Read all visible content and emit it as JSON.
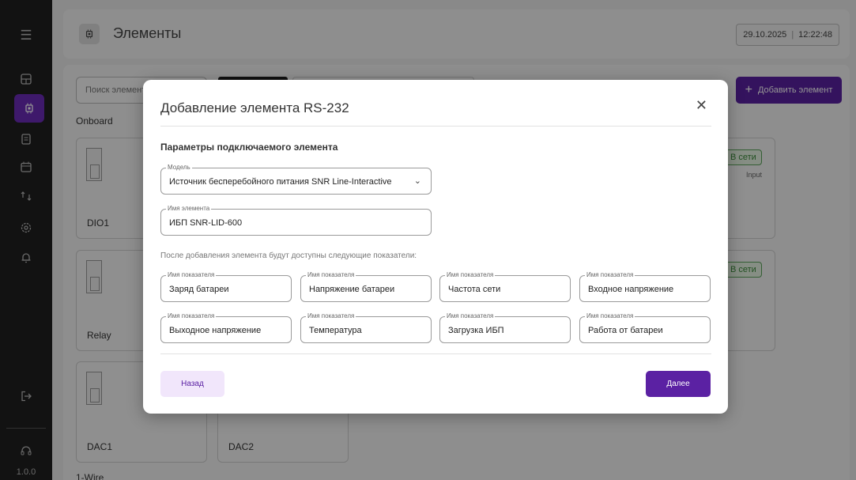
{
  "app": {
    "version": "1.0.0"
  },
  "header": {
    "title": "Элементы",
    "date": "29.10.2025",
    "time": "12:22:48"
  },
  "toolbar": {
    "search_placeholder": "Поиск элемент",
    "add_label": "Добавить элемент"
  },
  "groups": {
    "onboard": "Onboard",
    "onewire": "1-Wire"
  },
  "cards": {
    "dio1": "DIO1",
    "relay": "Relay",
    "dac1": "DAC1",
    "dac2": "DAC2"
  },
  "status": {
    "online1": "В сети",
    "online2": "В сети",
    "kind1": "Input"
  },
  "modal": {
    "title": "Добавление элемента RS-232",
    "subtitle": "Параметры подключаемого элемента",
    "model_label": "Модель",
    "model_value": "Источник бесперебойного питания SNR Line-Interactive",
    "name_label": "Имя элемента",
    "name_value": "ИБП SNR-LID-600",
    "info": "После добавления элемента будут доступны следующие показатели:",
    "indicator_label": "Имя показателя",
    "indicators": [
      "Заряд батареи",
      "Напряжение батареи",
      "Частота сети",
      "Входное напряжение",
      "Выходное напряжение",
      "Температура",
      "Загрузка ИБП",
      "Работа от батареи"
    ],
    "back_label": "Назад",
    "next_label": "Далее"
  },
  "colors": {
    "accent": "#5b21a3",
    "sidebar": "#1f1f1f",
    "online": "#3a8a3a"
  },
  "icons": {
    "sidebar": [
      "menu-icon",
      "dashboard-icon",
      "chip-icon",
      "document-icon",
      "calendar-icon",
      "sync-icon",
      "settings-icon",
      "bell-icon",
      "logout-icon",
      "support-icon"
    ]
  }
}
